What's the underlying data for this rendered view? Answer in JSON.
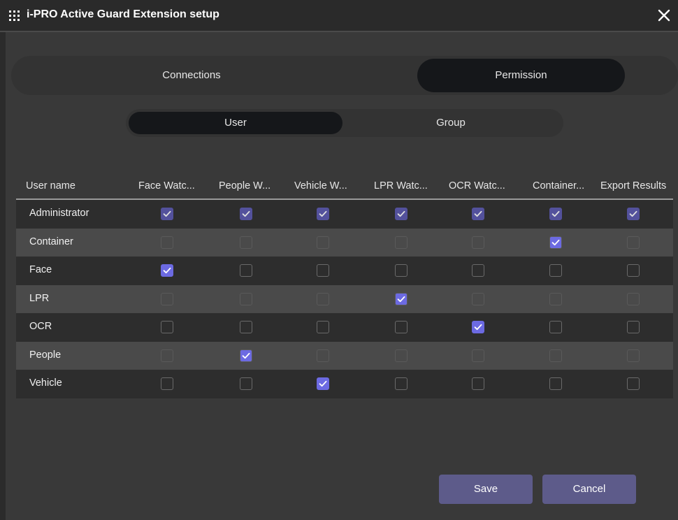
{
  "window": {
    "title": "i-PRO Active Guard Extension setup",
    "icon": "grid-dots-icon",
    "close_icon": "close-icon"
  },
  "main_tabs": [
    {
      "label": "Connections",
      "selected": false
    },
    {
      "label": "Permission",
      "selected": true
    }
  ],
  "sub_tabs": [
    {
      "label": "User",
      "selected": true
    },
    {
      "label": "Group",
      "selected": false
    }
  ],
  "table": {
    "columns": [
      "User name",
      "Face Watc...",
      "People W...",
      "Vehicle W...",
      "LPR Watc...",
      "OCR Watc...",
      "Container...",
      "Export Results"
    ],
    "rows": [
      {
        "name": "Administrator",
        "checks": [
          true,
          true,
          true,
          true,
          true,
          true,
          true
        ],
        "locked": true
      },
      {
        "name": "Container",
        "checks": [
          false,
          false,
          false,
          false,
          false,
          true,
          false
        ],
        "locked": false
      },
      {
        "name": "Face",
        "checks": [
          true,
          false,
          false,
          false,
          false,
          false,
          false
        ],
        "locked": false
      },
      {
        "name": "LPR",
        "checks": [
          false,
          false,
          false,
          true,
          false,
          false,
          false
        ],
        "locked": false
      },
      {
        "name": "OCR",
        "checks": [
          false,
          false,
          false,
          false,
          true,
          false,
          false
        ],
        "locked": false
      },
      {
        "name": "People",
        "checks": [
          false,
          true,
          false,
          false,
          false,
          false,
          false
        ],
        "locked": false
      },
      {
        "name": "Vehicle",
        "checks": [
          false,
          false,
          true,
          false,
          false,
          false,
          false
        ],
        "locked": false
      }
    ]
  },
  "buttons": {
    "save_label": "Save",
    "cancel_label": "Cancel"
  },
  "colors": {
    "accent": "#6c6ae2",
    "button": "#5d5b8a",
    "selected_tab": "#15171a"
  }
}
